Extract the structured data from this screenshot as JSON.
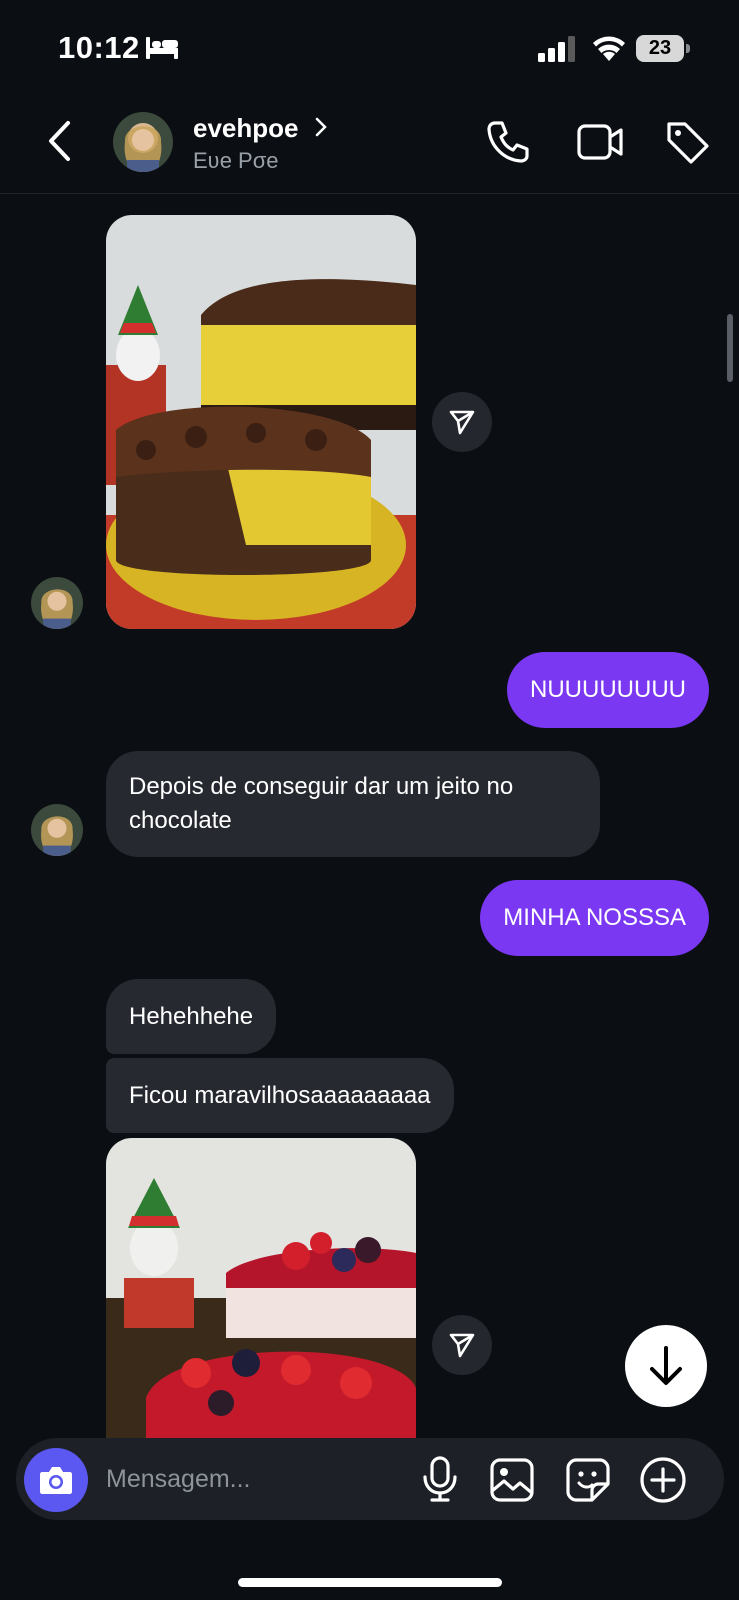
{
  "status_bar": {
    "time": "10:12",
    "battery": "23"
  },
  "header": {
    "username": "evehpoe",
    "full_name": "Eʋe Pσe"
  },
  "messages": {
    "incoming_1": "Depois de conseguir dar um jeito no chocolate",
    "outgoing_1": "NUUUUUUUU",
    "outgoing_2": "MINHA NOSSSA",
    "incoming_2": "Hehehhehe",
    "incoming_3": "Ficou maravilhosaaaaaaaaa"
  },
  "composer": {
    "placeholder": "Mensagem..."
  },
  "colors": {
    "background": "#0b0e13",
    "outgoing_bubble": "#7b38f2",
    "incoming_bubble": "#262a30",
    "camera_button": "#5a58f0"
  },
  "icons": [
    "bed-icon",
    "signal-icon",
    "wifi-icon",
    "back-icon",
    "chevron-right-icon",
    "phone-icon",
    "video-icon",
    "tag-icon",
    "share-icon",
    "arrow-down-icon",
    "camera-icon",
    "mic-icon",
    "gallery-icon",
    "sticker-icon",
    "plus-icon"
  ]
}
